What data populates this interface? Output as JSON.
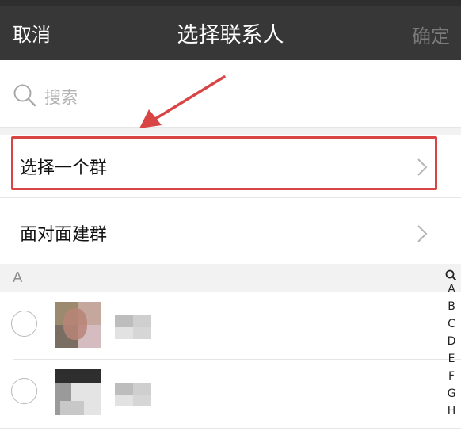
{
  "navbar": {
    "cancel_label": "取消",
    "title": "选择联系人",
    "confirm_label": "确定"
  },
  "search": {
    "placeholder": "搜索"
  },
  "menu": {
    "select_group_label": "选择一个群",
    "face_to_face_label": "面对面建群"
  },
  "contacts": {
    "section_letter": "A",
    "items": [
      {
        "selected": false
      },
      {
        "selected": false
      }
    ]
  },
  "index_bar": {
    "letters": [
      "A",
      "B",
      "C",
      "D",
      "E",
      "F",
      "G",
      "H"
    ]
  },
  "colors": {
    "navbar_bg": "#373737",
    "highlight": "#d94545",
    "arrow": "#d94545"
  },
  "icons": {
    "search": "magnifier-icon",
    "chevron": "chevron-right-icon",
    "index_search": "magnifier-icon"
  }
}
